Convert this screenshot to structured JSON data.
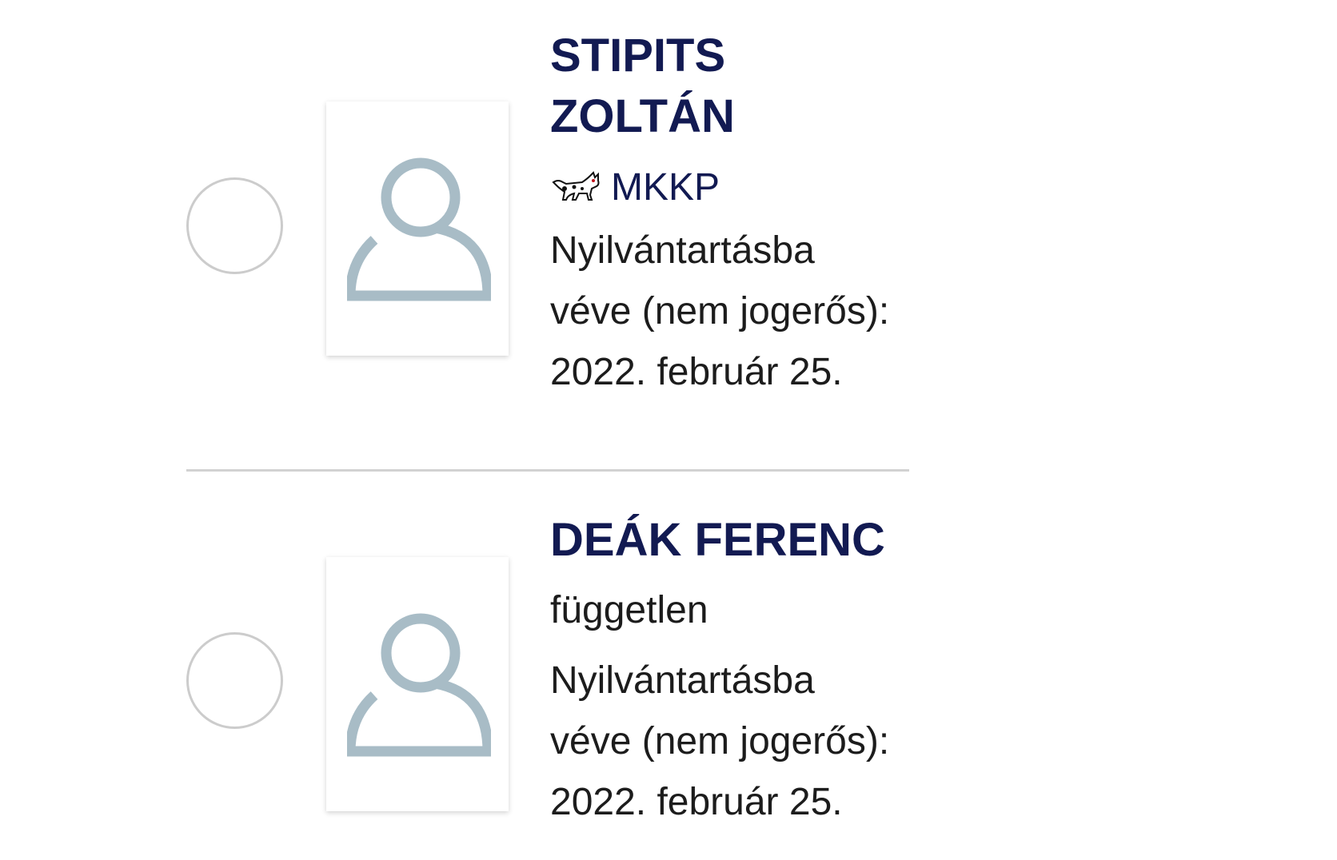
{
  "candidates": [
    {
      "name_line1": "STIPITS",
      "name_line2": "ZOLTÁN",
      "party": "MKKP",
      "party_icon": "dog-icon",
      "status_line1": "Nyilvántartásba",
      "status_line2": "véve (nem jogerős):",
      "status_line3": "2022. február 25."
    },
    {
      "name": "DEÁK FERENC",
      "party": "független",
      "status_line1": "Nyilvántartásba",
      "status_line2": "véve (nem jogerős):",
      "status_line3": "2022. február 25."
    }
  ],
  "colors": {
    "name": "#121a52",
    "text": "#1c1c1c",
    "avatar": "#a8bcc6",
    "radio_border": "#cccccc",
    "divider": "#d2d2d2"
  }
}
